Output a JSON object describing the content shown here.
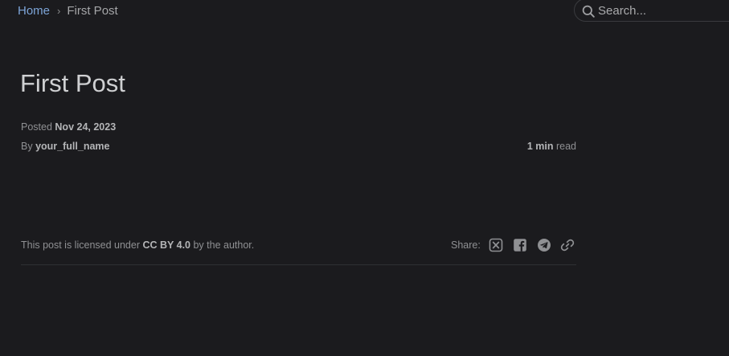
{
  "breadcrumb": {
    "home": "Home",
    "separator": "›",
    "current": "First Post"
  },
  "search": {
    "placeholder": "Search...",
    "icon": "search-icon"
  },
  "post": {
    "title": "First Post",
    "posted_label": "Posted",
    "posted_date": "Nov 24, 2023",
    "by_label": "By",
    "author": "your_full_name",
    "read_time_value": "1 min",
    "read_time_suffix": "read"
  },
  "footer": {
    "license_prefix": "This post is licensed under",
    "license_name": "CC BY 4.0",
    "license_suffix": "by the author.",
    "share_label": "Share:",
    "share_icons": [
      "x-icon",
      "facebook-icon",
      "telegram-icon",
      "link-icon"
    ]
  },
  "colors": {
    "background": "#1b1b1e",
    "link": "#7da5d8",
    "text": "#afb0b1",
    "title": "#cfd0d2"
  }
}
